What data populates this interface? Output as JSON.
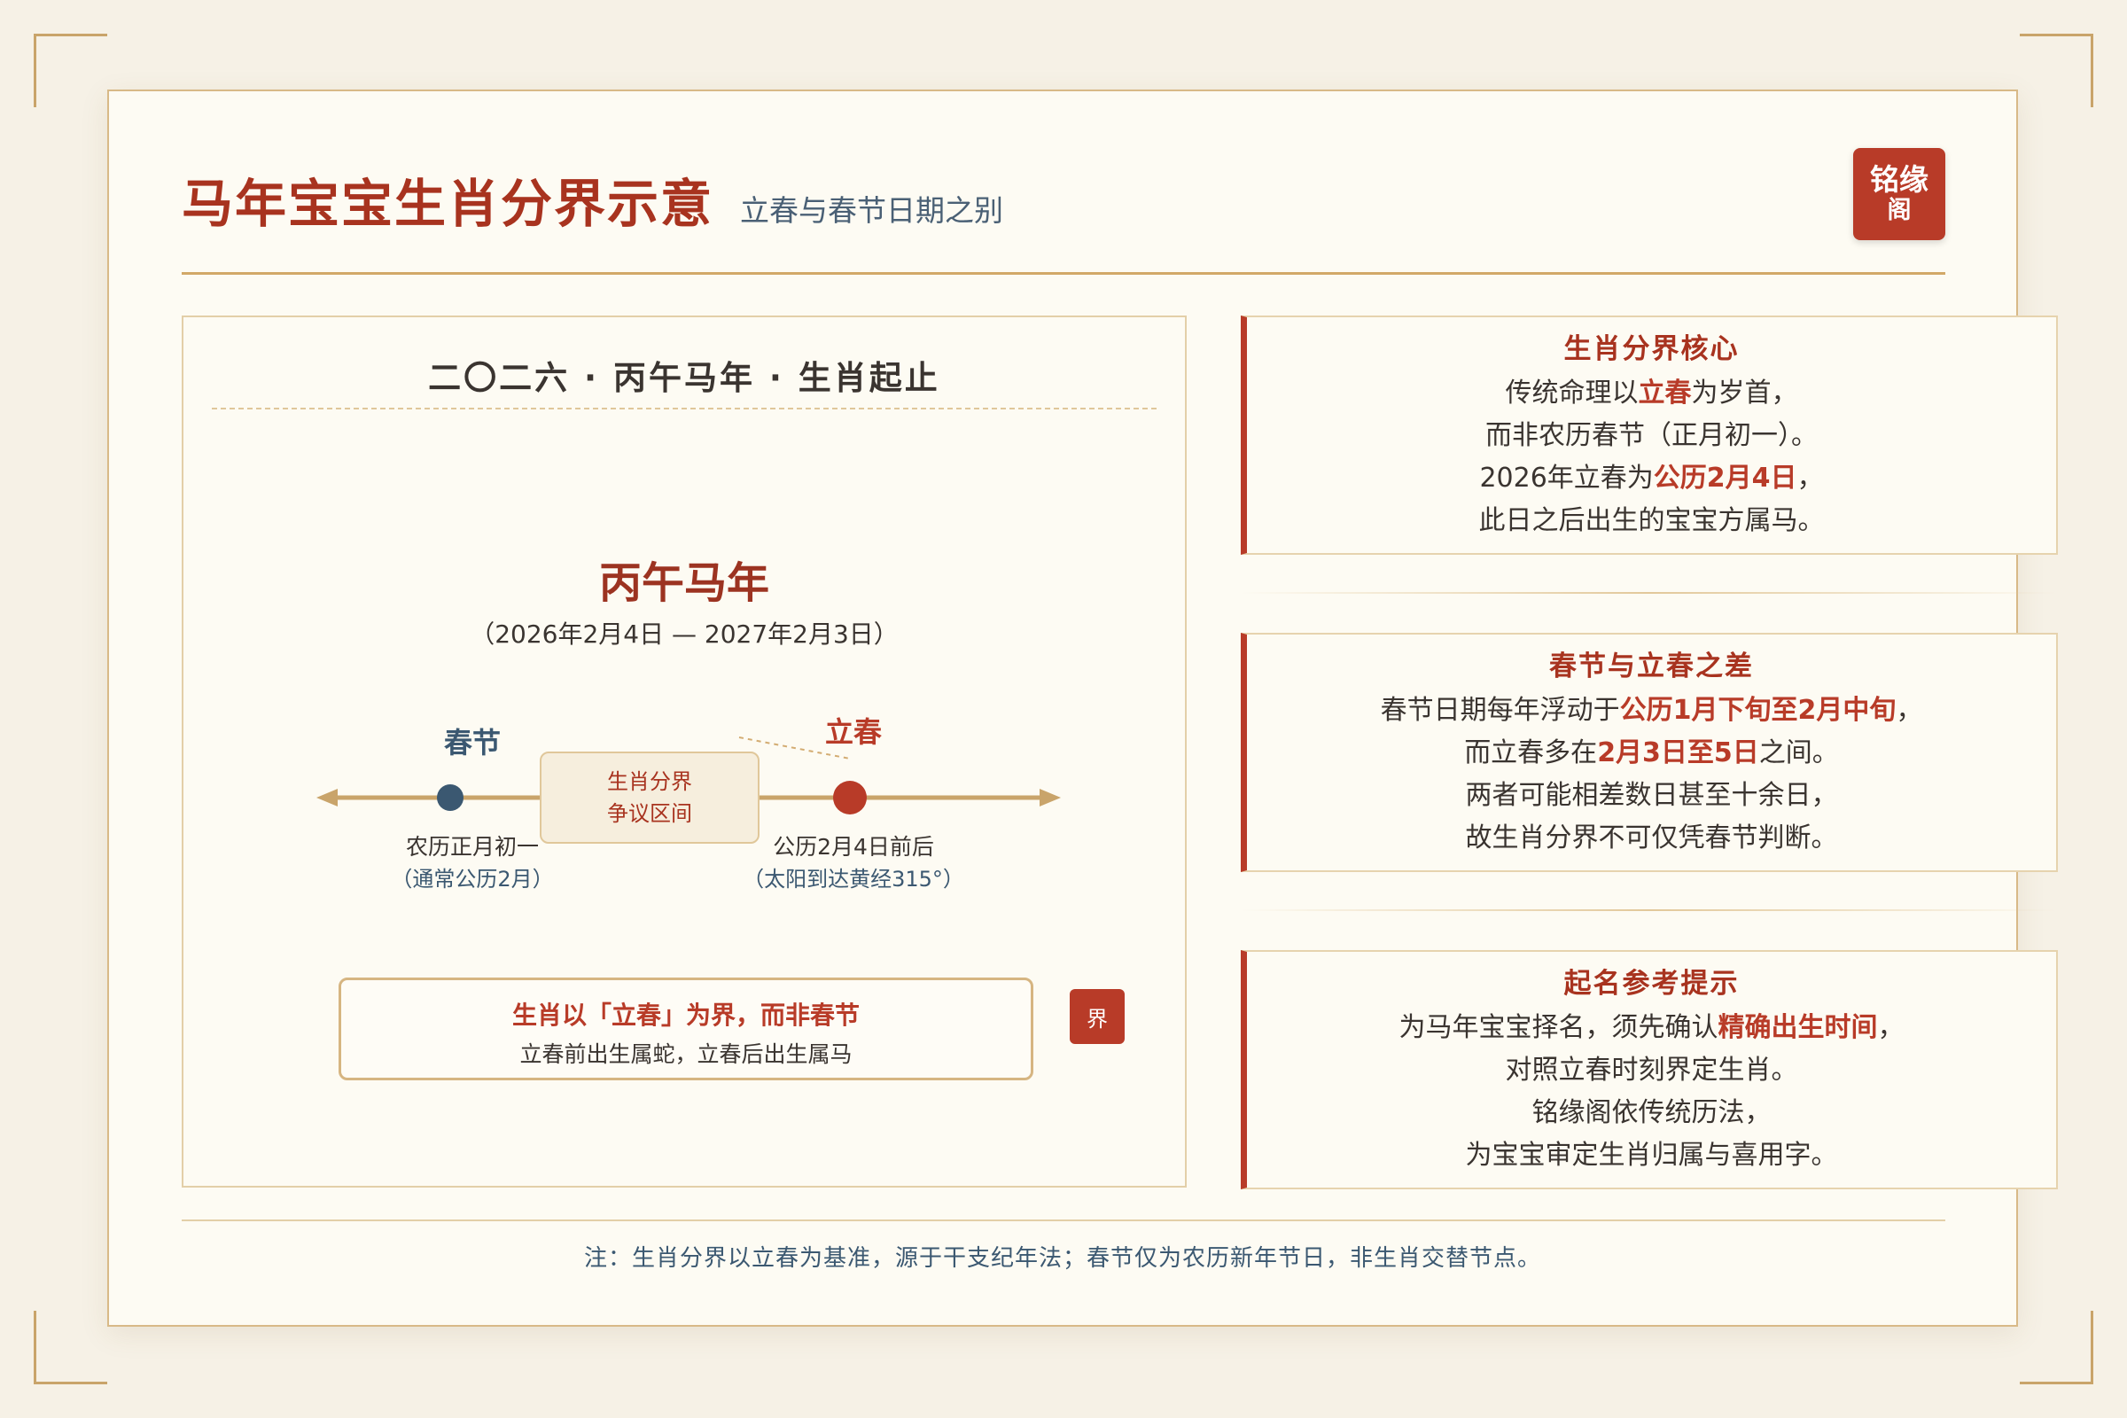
{
  "header": {
    "title": "马年宝宝生肖分界示意",
    "subtitle": "立春与春节日期之别",
    "seal_line1": "铭缘",
    "seal_line2": "阁"
  },
  "diagram": {
    "heading": "二〇二六 · 丙午马年 · 生肖起止",
    "year_title": "丙午马年",
    "year_range": "（2026年2月4日 — 2027年2月3日）",
    "spring_festival": {
      "label": "春节",
      "line1": "农历正月初一",
      "line2": "（通常公历2月）"
    },
    "lichun": {
      "label": "立春",
      "line1": "公历2月4日前后",
      "line2": "（太阳到达黄经315°）"
    },
    "dispute_line1": "生肖分界",
    "dispute_line2": "争议区间",
    "rule_main": "生肖以「立春」为界，而非春节",
    "rule_sub": "立春前出生属蛇，立春后出生属马",
    "rule_seal": "界"
  },
  "cards": [
    {
      "title": "生肖分界核心",
      "lines": [
        [
          {
            "t": "传统命理以"
          },
          {
            "t": "立春",
            "hl": true
          },
          {
            "t": "为岁首，"
          }
        ],
        [
          {
            "t": "而非农历春节（正月初一）。"
          }
        ],
        [
          {
            "t": "2026年立春为"
          },
          {
            "t": "公历2月4日",
            "hl": true
          },
          {
            "t": "，"
          }
        ],
        [
          {
            "t": "此日之后出生的宝宝方属马。"
          }
        ]
      ]
    },
    {
      "title": "春节与立春之差",
      "lines": [
        [
          {
            "t": "春节日期每年浮动于"
          },
          {
            "t": "公历1月下旬至2月中旬",
            "hl": true
          },
          {
            "t": "，"
          }
        ],
        [
          {
            "t": "而立春多在"
          },
          {
            "t": "2月3日至5日",
            "hl": true
          },
          {
            "t": "之间。"
          }
        ],
        [
          {
            "t": "两者可能相差数日甚至十余日，"
          }
        ],
        [
          {
            "t": "故生肖分界不可仅凭春节判断。"
          }
        ]
      ]
    },
    {
      "title": "起名参考提示",
      "lines": [
        [
          {
            "t": "为马年宝宝择名，须先确认"
          },
          {
            "t": "精确出生时间",
            "hl": true
          },
          {
            "t": "，"
          }
        ],
        [
          {
            "t": "对照立春时刻界定生肖。"
          }
        ],
        [
          {
            "t": "铭缘阁依传统历法，"
          }
        ],
        [
          {
            "t": "为宝宝审定生肖归属与喜用字。"
          }
        ]
      ]
    }
  ],
  "footnote": "注：生肖分界以立春为基准，源于干支纪年法；春节仅为农历新年节日，非生肖交替节点。",
  "colors": {
    "accent_red": "#b83b28",
    "spring_dot": "#3b5871",
    "axis": "#c9a46a"
  }
}
